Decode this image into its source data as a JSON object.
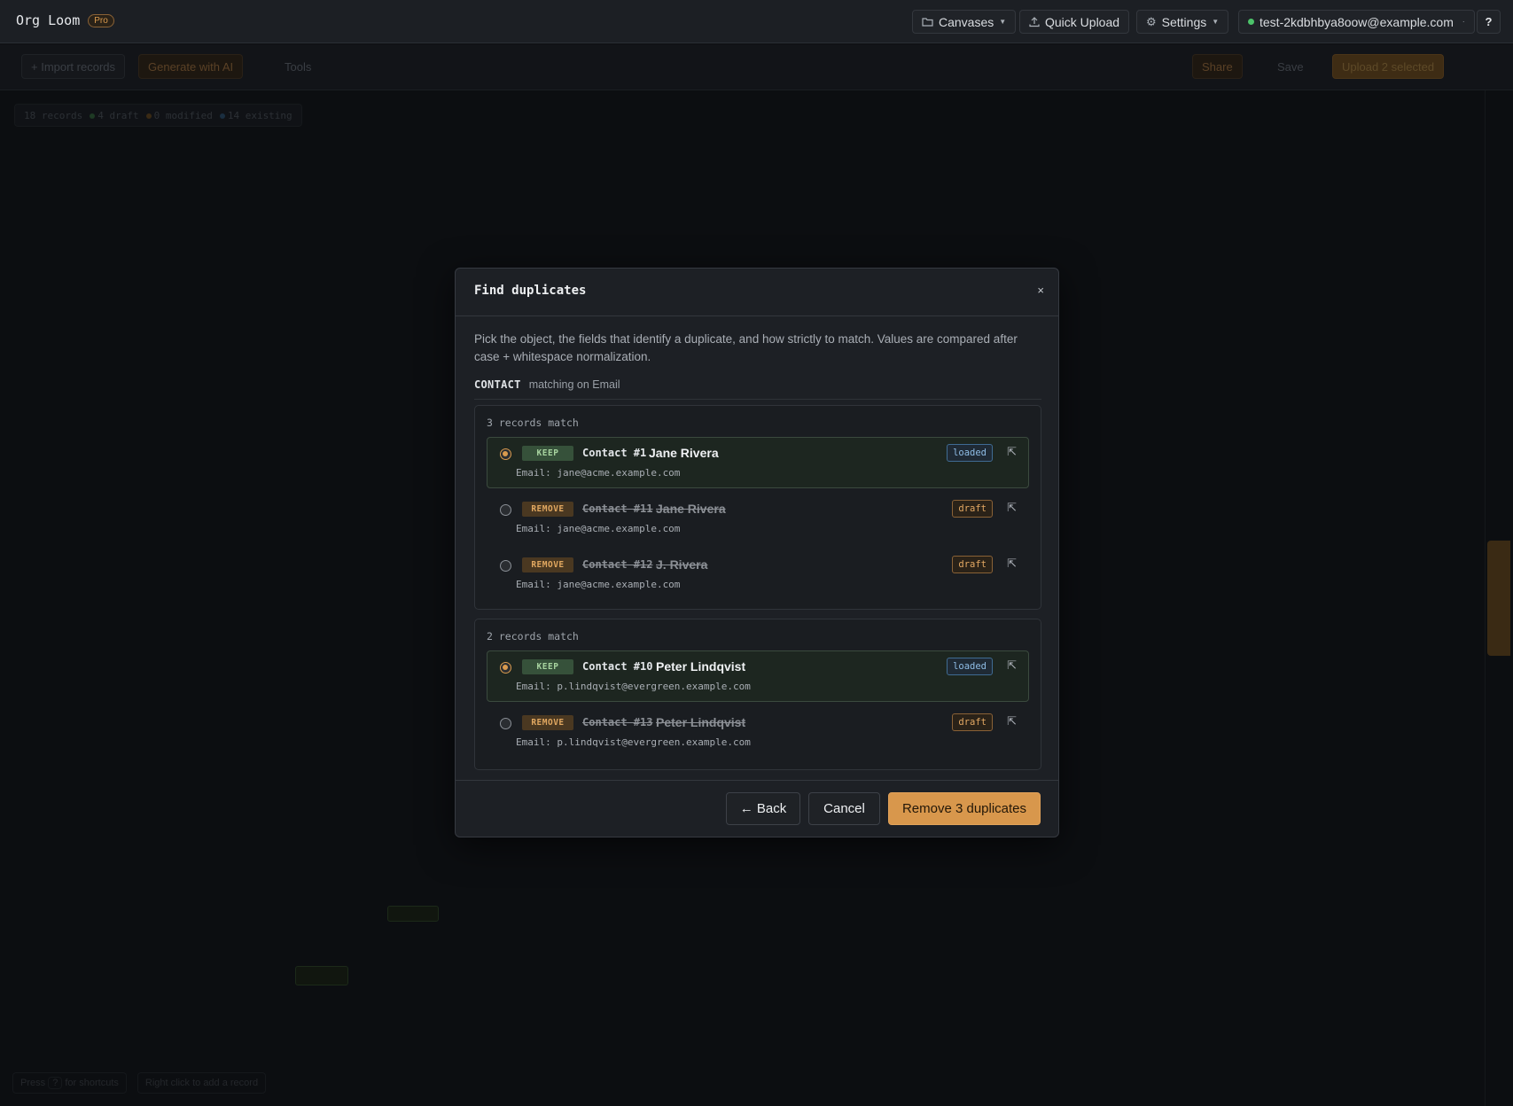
{
  "app": {
    "name": "Org Loom",
    "plan_badge": "Pro"
  },
  "topbar": {
    "canvases_label": "Canvases",
    "quick_upload_label": "Quick Upload",
    "settings_label": "Settings",
    "user_email": "test-2kdbhbya8oow@example.com",
    "help_label": "?"
  },
  "toolbar": {
    "import_label": "+ Import records",
    "generate_label": "Generate with AI",
    "tools_label": "Tools",
    "share_label": "Share",
    "save_label": "Save",
    "upload_label": "Upload 2 selected"
  },
  "stats": {
    "records": "18 records",
    "draft": "4 draft",
    "modified": "0 modified",
    "existing": "14 existing",
    "colors": {
      "draft": "#4cc36a",
      "modified": "#d99a4e",
      "existing": "#4a8fd1"
    }
  },
  "footer_hints": {
    "press": "Press",
    "key": "?",
    "shortcuts": "for shortcuts",
    "right_click": "Right click to add a record"
  },
  "modal": {
    "title": "Find duplicates",
    "close_label": "×",
    "description": "Pick the object, the fields that identify a duplicate, and how strictly to match. Values are compared after case + whitespace normalization.",
    "object": "CONTACT",
    "matching": "matching on Email",
    "groups": [
      {
        "count_label": "3 records match",
        "records": [
          {
            "action": "KEEP",
            "id": "Contact #1",
            "name": "Jane Rivera",
            "email": "Email: jane@acme.example.com",
            "state": "loaded",
            "selected": true
          },
          {
            "action": "REMOVE",
            "id": "Contact #11",
            "name": "Jane Rivera",
            "email": "Email: jane@acme.example.com",
            "state": "draft",
            "selected": false
          },
          {
            "action": "REMOVE",
            "id": "Contact #12",
            "name": "J. Rivera",
            "email": "Email: jane@acme.example.com",
            "state": "draft",
            "selected": false
          }
        ]
      },
      {
        "count_label": "2 records match",
        "records": [
          {
            "action": "KEEP",
            "id": "Contact #10",
            "name": "Peter Lindqvist",
            "email": "Email: p.lindqvist@evergreen.example.com",
            "state": "loaded",
            "selected": true
          },
          {
            "action": "REMOVE",
            "id": "Contact #13",
            "name": "Peter Lindqvist",
            "email": "Email: p.lindqvist@evergreen.example.com",
            "state": "draft",
            "selected": false
          }
        ]
      }
    ],
    "back_label": "← Back",
    "cancel_label": "Cancel",
    "remove_label": "Remove 3 duplicates",
    "colors": {
      "accent": "#d8974c",
      "keep": "#a7d39f",
      "loaded": "#8fbde6"
    }
  }
}
